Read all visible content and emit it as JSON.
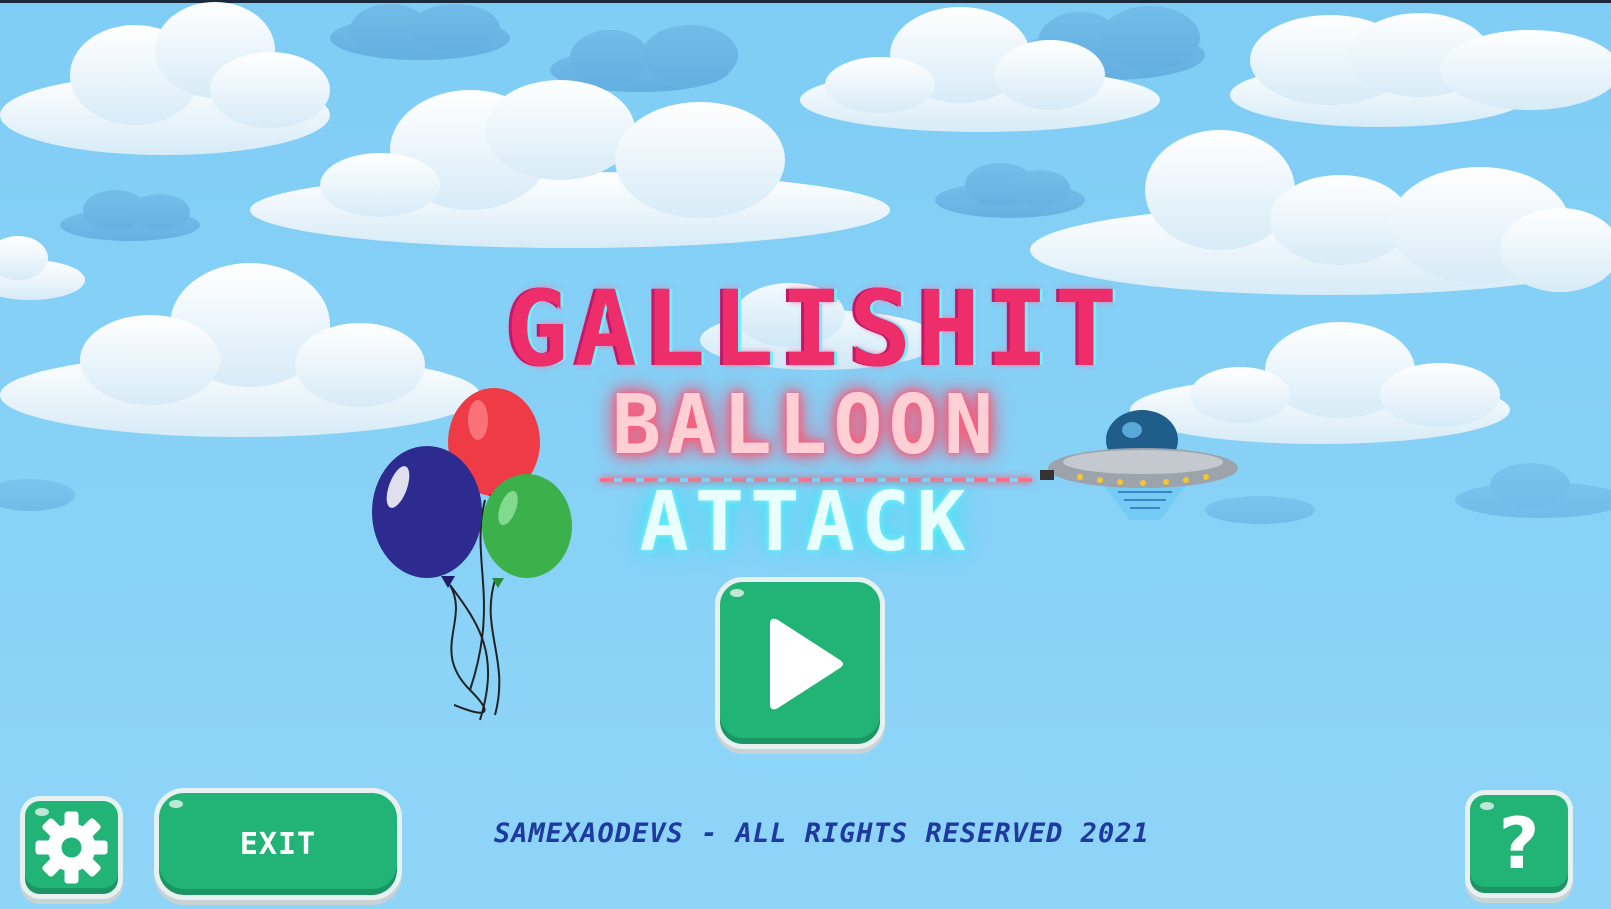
{
  "game": {
    "title": "GALLISHIT",
    "subtitle_top": "BALLOON",
    "subtitle_bottom": "ATTACK"
  },
  "buttons": {
    "play": {
      "icon": "play-icon"
    },
    "settings": {
      "icon": "gear-icon"
    },
    "exit": {
      "label": "EXIT"
    },
    "help": {
      "label": "?"
    }
  },
  "footer": {
    "copyright": "SAMEXAODEVS - ALL RIGHTS RESERVED 2021"
  },
  "decorations": {
    "balloons": [
      "red",
      "navy",
      "green"
    ],
    "ufo": "ufo-icon"
  },
  "colors": {
    "sky": "#8ed3f7",
    "button_green": "#22b377",
    "title_pink": "#ee2d6b",
    "balloon_red": "#ee3b45",
    "balloon_navy": "#2d2b8f",
    "balloon_green": "#3bb04b",
    "copyright_blue": "#1f3a9e"
  }
}
